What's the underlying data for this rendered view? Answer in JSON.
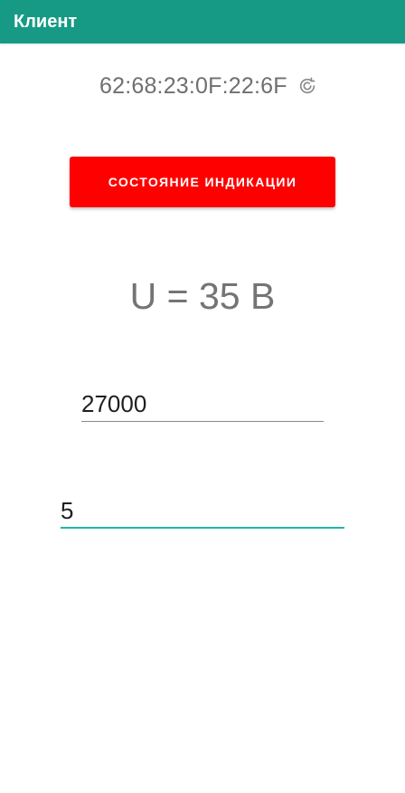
{
  "app_bar": {
    "title": "Клиент"
  },
  "device": {
    "mac_address": "62:68:23:0F:22:6F",
    "refresh_icon": "refresh-icon"
  },
  "indication_button": {
    "label": "СОСТОЯНИЕ ИНДИКАЦИИ"
  },
  "voltage": {
    "text": "U = 35 B"
  },
  "inputs": {
    "field_1_value": "27000",
    "field_2_value": "5"
  },
  "colors": {
    "app_bar": "#169a85",
    "button": "#fe0000",
    "accent_underline": "#1fb5ac",
    "secondary_text": "#6f6f6f"
  }
}
